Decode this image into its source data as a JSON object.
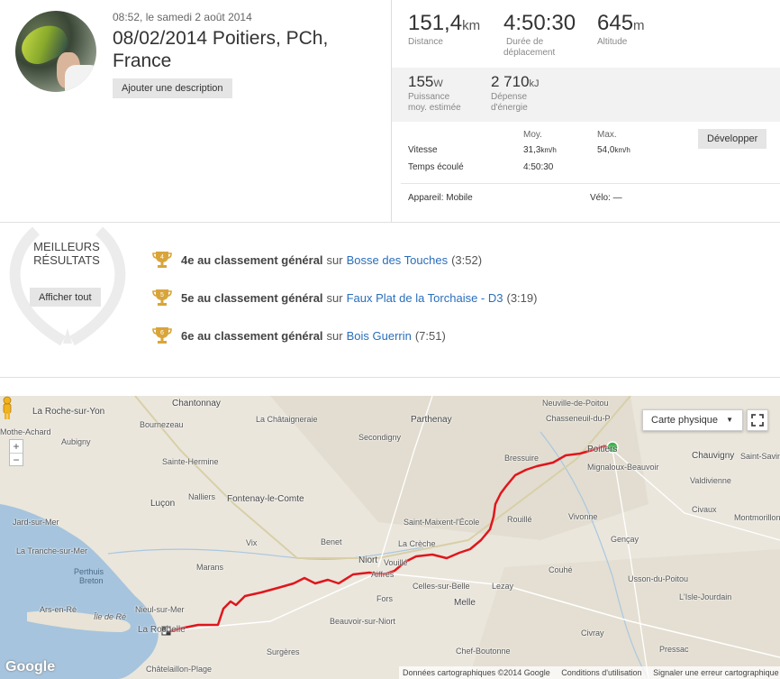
{
  "activity": {
    "date_line": "08:52, le samedi 2 août 2014",
    "title": "08/02/2014 Poitiers, PCh, France",
    "add_description": "Ajouter une description"
  },
  "stats": {
    "distance": {
      "value": "151,4",
      "unit": "km",
      "label": "Distance"
    },
    "moving_time": {
      "value": "4:50:30",
      "label_line1": "Durée de",
      "label_line2": "déplacement"
    },
    "elevation": {
      "value": "645",
      "unit": "m",
      "label": "Altitude"
    },
    "power": {
      "value": "155",
      "unit": "W",
      "label_line1": "Puissance",
      "label_line2": "moy. estimée"
    },
    "energy": {
      "value": "2 710",
      "unit": "kJ",
      "label_line1": "Dépense",
      "label_line2": "d'énergie"
    }
  },
  "details": {
    "col_avg": "Moy.",
    "col_max": "Max.",
    "develop_button": "Développer",
    "speed_label": "Vitesse",
    "speed_avg": "31,3",
    "speed_avg_unit": "km/h",
    "speed_max": "54,0",
    "speed_max_unit": "km/h",
    "elapsed_label": "Temps écoulé",
    "elapsed_avg": "4:50:30",
    "device": "Appareil: Mobile",
    "bike": "Vélo: —"
  },
  "best_results": {
    "title_line1": "MEILLEURS",
    "title_line2": "RÉSULTATS",
    "show_all": "Afficher tout",
    "items": [
      {
        "rank_num": "4",
        "rank": "4e au classement général",
        "sur": "sur",
        "segment": "Bosse des Touches",
        "time": "(3:52)"
      },
      {
        "rank_num": "5",
        "rank": "5e au classement général",
        "sur": "sur",
        "segment": "Faux Plat de la Torchaise - D3",
        "time": "(3:19)"
      },
      {
        "rank_num": "6",
        "rank": "6e au classement général",
        "sur": "sur",
        "segment": "Bois Guerrin",
        "time": "(7:51)"
      }
    ]
  },
  "map": {
    "map_type": "Carte physique",
    "zoom_in": "+",
    "zoom_out": "−",
    "google": "Google",
    "footer_data": "Données cartographiques ©2014 Google",
    "footer_terms": "Conditions d'utilisation",
    "footer_report": "Signaler une erreur cartographique",
    "sea_label_1": "Perthuis",
    "sea_label_2": "Breton",
    "island_label": "Île de Ré",
    "towns": [
      {
        "name": "Chantonnay"
      },
      {
        "name": "La Roche-sur-Yon"
      },
      {
        "name": "Mothe-Achard"
      },
      {
        "name": "Bournezeau"
      },
      {
        "name": "Aubigny"
      },
      {
        "name": "La Châtaigneraie"
      },
      {
        "name": "Parthenay"
      },
      {
        "name": "Neuville-de-Poitou"
      },
      {
        "name": "Chasseneuil-du-P"
      },
      {
        "name": "Secondigny"
      },
      {
        "name": "Sainte-Hermine"
      },
      {
        "name": "Bressuire"
      },
      {
        "name": "Poitiers"
      },
      {
        "name": "Chauvigny"
      },
      {
        "name": "Saint-Savin"
      },
      {
        "name": "Mignaloux-Beauvoir"
      },
      {
        "name": "Nalliers"
      },
      {
        "name": "Fontenay-le-Comte"
      },
      {
        "name": "Valdivienne"
      },
      {
        "name": "Luçon"
      },
      {
        "name": "Saint-Maixent-l'École"
      },
      {
        "name": "Rouillé"
      },
      {
        "name": "Vivonne"
      },
      {
        "name": "Civaux"
      },
      {
        "name": "Jard-sur-Mer"
      },
      {
        "name": "Montmorillon"
      },
      {
        "name": "Vix"
      },
      {
        "name": "Benet"
      },
      {
        "name": "La Crèche"
      },
      {
        "name": "Gençay"
      },
      {
        "name": "La Tranche-sur-Mer"
      },
      {
        "name": "Niort"
      },
      {
        "name": "Vouillé"
      },
      {
        "name": "Marans"
      },
      {
        "name": "Aiffres"
      },
      {
        "name": "Couhé"
      },
      {
        "name": "Celles-sur-Belle"
      },
      {
        "name": "Usson-du-Poitou"
      },
      {
        "name": "Lezay"
      },
      {
        "name": "Ars-en-Ré"
      },
      {
        "name": "Fors"
      },
      {
        "name": "Melle"
      },
      {
        "name": "L'Isle-Jourdain"
      },
      {
        "name": "Nieul-sur-Mer"
      },
      {
        "name": "Civray"
      },
      {
        "name": "Beauvoir-sur-Niort"
      },
      {
        "name": "La Rochelle"
      },
      {
        "name": "Surgères"
      },
      {
        "name": "Chef-Boutonne"
      },
      {
        "name": "Pressac"
      },
      {
        "name": "Châtelaillon-Plage"
      }
    ]
  },
  "colors": {
    "route": "#e0161c",
    "link": "#2a6ebb",
    "trophy": "#d9a53a",
    "start_marker": "#3cb34a",
    "sea": "#a6c4dd",
    "land": "#eae6dc"
  }
}
